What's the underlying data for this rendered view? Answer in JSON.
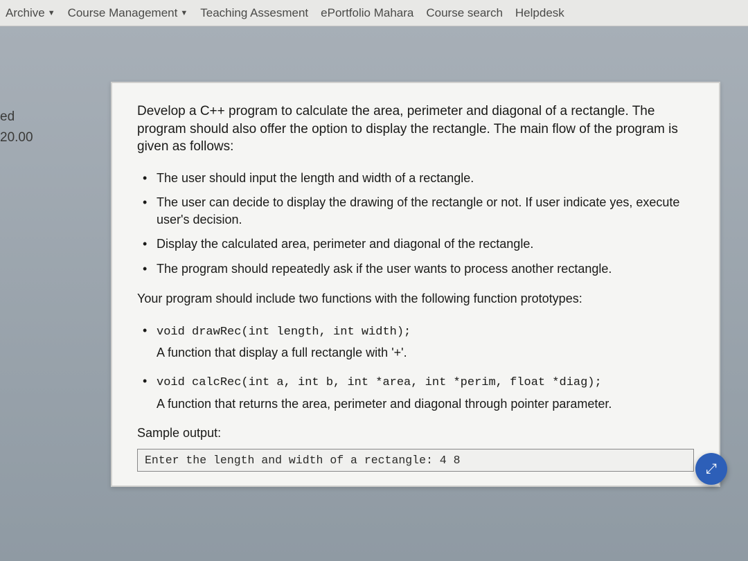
{
  "nav": {
    "archive": "Archive",
    "course_mgmt": "Course Management",
    "teaching": "Teaching Assesment",
    "portfolio": "ePortfolio Mahara",
    "search": "Course search",
    "helpdesk": "Helpdesk"
  },
  "sidebar": {
    "line1": "ed",
    "line2": "20.00"
  },
  "content": {
    "intro": "Develop a C++ program to calculate the area, perimeter and diagonal of a rectangle. The program should also offer the option to display the rectangle. The main flow of the program is given as follows:",
    "bullets": [
      "The user should input the length and width of a rectangle.",
      "The user can decide to display the drawing of the rectangle or not. If user indicate yes, execute user's decision.",
      "Display the calculated area, perimeter and diagonal of the rectangle.",
      "The program should repeatedly ask if the user wants to process another rectangle."
    ],
    "sub_intro": "Your program should include two functions with the following function prototypes:",
    "funcs": [
      {
        "proto": "void drawRec(int length, int width);",
        "desc": "A function that display a full rectangle with '+'."
      },
      {
        "proto": "void calcRec(int a, int b, int *area, int *perim, float *diag);",
        "desc": "A function that returns the area, perimeter and diagonal through pointer parameter."
      }
    ],
    "sample_label": "Sample output:",
    "sample_text": "Enter the length and width of a rectangle: 4 8"
  }
}
